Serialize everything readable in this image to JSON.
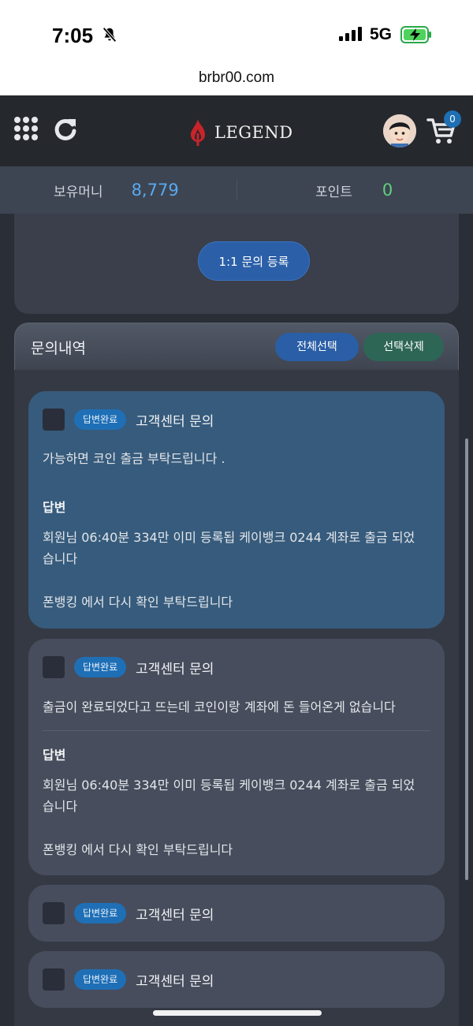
{
  "status_bar": {
    "time": "7:05",
    "network": "5G"
  },
  "url": "brbr00.com",
  "header": {
    "logo_text": "LEGEND",
    "cart_count": "0"
  },
  "balance": {
    "money_label": "보유머니",
    "money_value": "8,779",
    "point_label": "포인트",
    "point_value": "0"
  },
  "register_button": "1:1 문의 등록",
  "inquiry_list": {
    "title": "문의내역",
    "select_all": "전체선택",
    "delete_selected": "선택삭제",
    "items": [
      {
        "status": "답변완료",
        "title": "고객센터 문의",
        "question": "가능하면 코인 출금 부탁드립니다 .",
        "answer_label": "답변",
        "answer_line1": "회원님 06:40분 334만 이미 등록됩 케이뱅크 0244 계좌로 출금 되었",
        "answer_line2": "습니다",
        "answer_line3": "폰뱅킹 에서 다시 확인 부탁드립니다"
      },
      {
        "status": "답변완료",
        "title": "고객센터 문의",
        "question": "출금이 완료되었다고 뜨는데 코인이랑 계좌에 돈 들어온게 없습니다",
        "answer_label": "답변",
        "answer_line1": "회원님 06:40분 334만 이미 등록됩 케이뱅크 0244 계좌로 출금 되었",
        "answer_line2": "습니다",
        "answer_line3": "폰뱅킹 에서 다시 확인 부탁드립니다"
      },
      {
        "status": "답변완료",
        "title": "고객센터 문의"
      },
      {
        "status": "답변완료",
        "title": "고객센터 문의"
      }
    ]
  },
  "colors": {
    "accent_blue": "#2b5fa8",
    "money": "#5aa9f0",
    "point": "#5fd17c",
    "badge": "#1f6fb6"
  }
}
